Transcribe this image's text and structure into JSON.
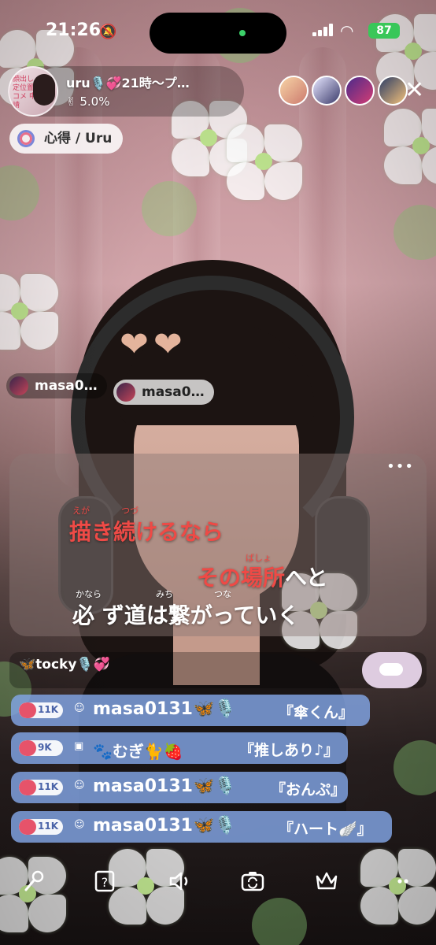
{
  "status_bar": {
    "time": "21:26",
    "battery": "87"
  },
  "host": {
    "name": "uru🎙️💞21時〜プ…",
    "progress": "5.0%",
    "avatar_badge": "顔出し 定位置 コメ 申請"
  },
  "song": {
    "label": "心得 / Uru"
  },
  "overlay": {
    "hearts": "❤️❤️",
    "name_chip_1": "masa0…",
    "name_chip_2": "masa0…"
  },
  "lyrics": {
    "more": "•••",
    "line1": {
      "text": "描き続けるなら",
      "ruby_a": "えが",
      "ruby_b": "つづ"
    },
    "line2": {
      "red": "その場所",
      "white": "へと",
      "ruby": "ばしょ"
    },
    "line3": {
      "text": "必 ず道は繋がっていく",
      "ruby_a": "かなら",
      "ruby_b": "みち",
      "ruby_c": "つな"
    }
  },
  "comments": {
    "tocky": "🦋tocky🎙️💞"
  },
  "gifts": [
    {
      "level": "11K",
      "name": "masa0131",
      "deco": "🦋🎙️",
      "message": "『傘くん』"
    },
    {
      "level": "9K",
      "name": "🐾むぎ🐈🍓",
      "deco": "",
      "message": "『推しあり♪』"
    },
    {
      "level": "11K",
      "name": "masa0131",
      "deco": "🦋🎙️",
      "message": "『おんぷ』"
    },
    {
      "level": "11K",
      "name": "masa0131",
      "deco": "🦋🎙️",
      "message": "『ハート🪽』"
    }
  ],
  "toolbar": {
    "mic": "mic-icon",
    "quiz": "question-box-icon",
    "speaker": "speaker-icon",
    "camera": "camera-flip-icon",
    "crown": "crown-icon",
    "more": "more-icon"
  },
  "colors": {
    "lyric_sung": "#ee4a46",
    "gift_row": "#82a6e6",
    "battery": "#39c759"
  }
}
